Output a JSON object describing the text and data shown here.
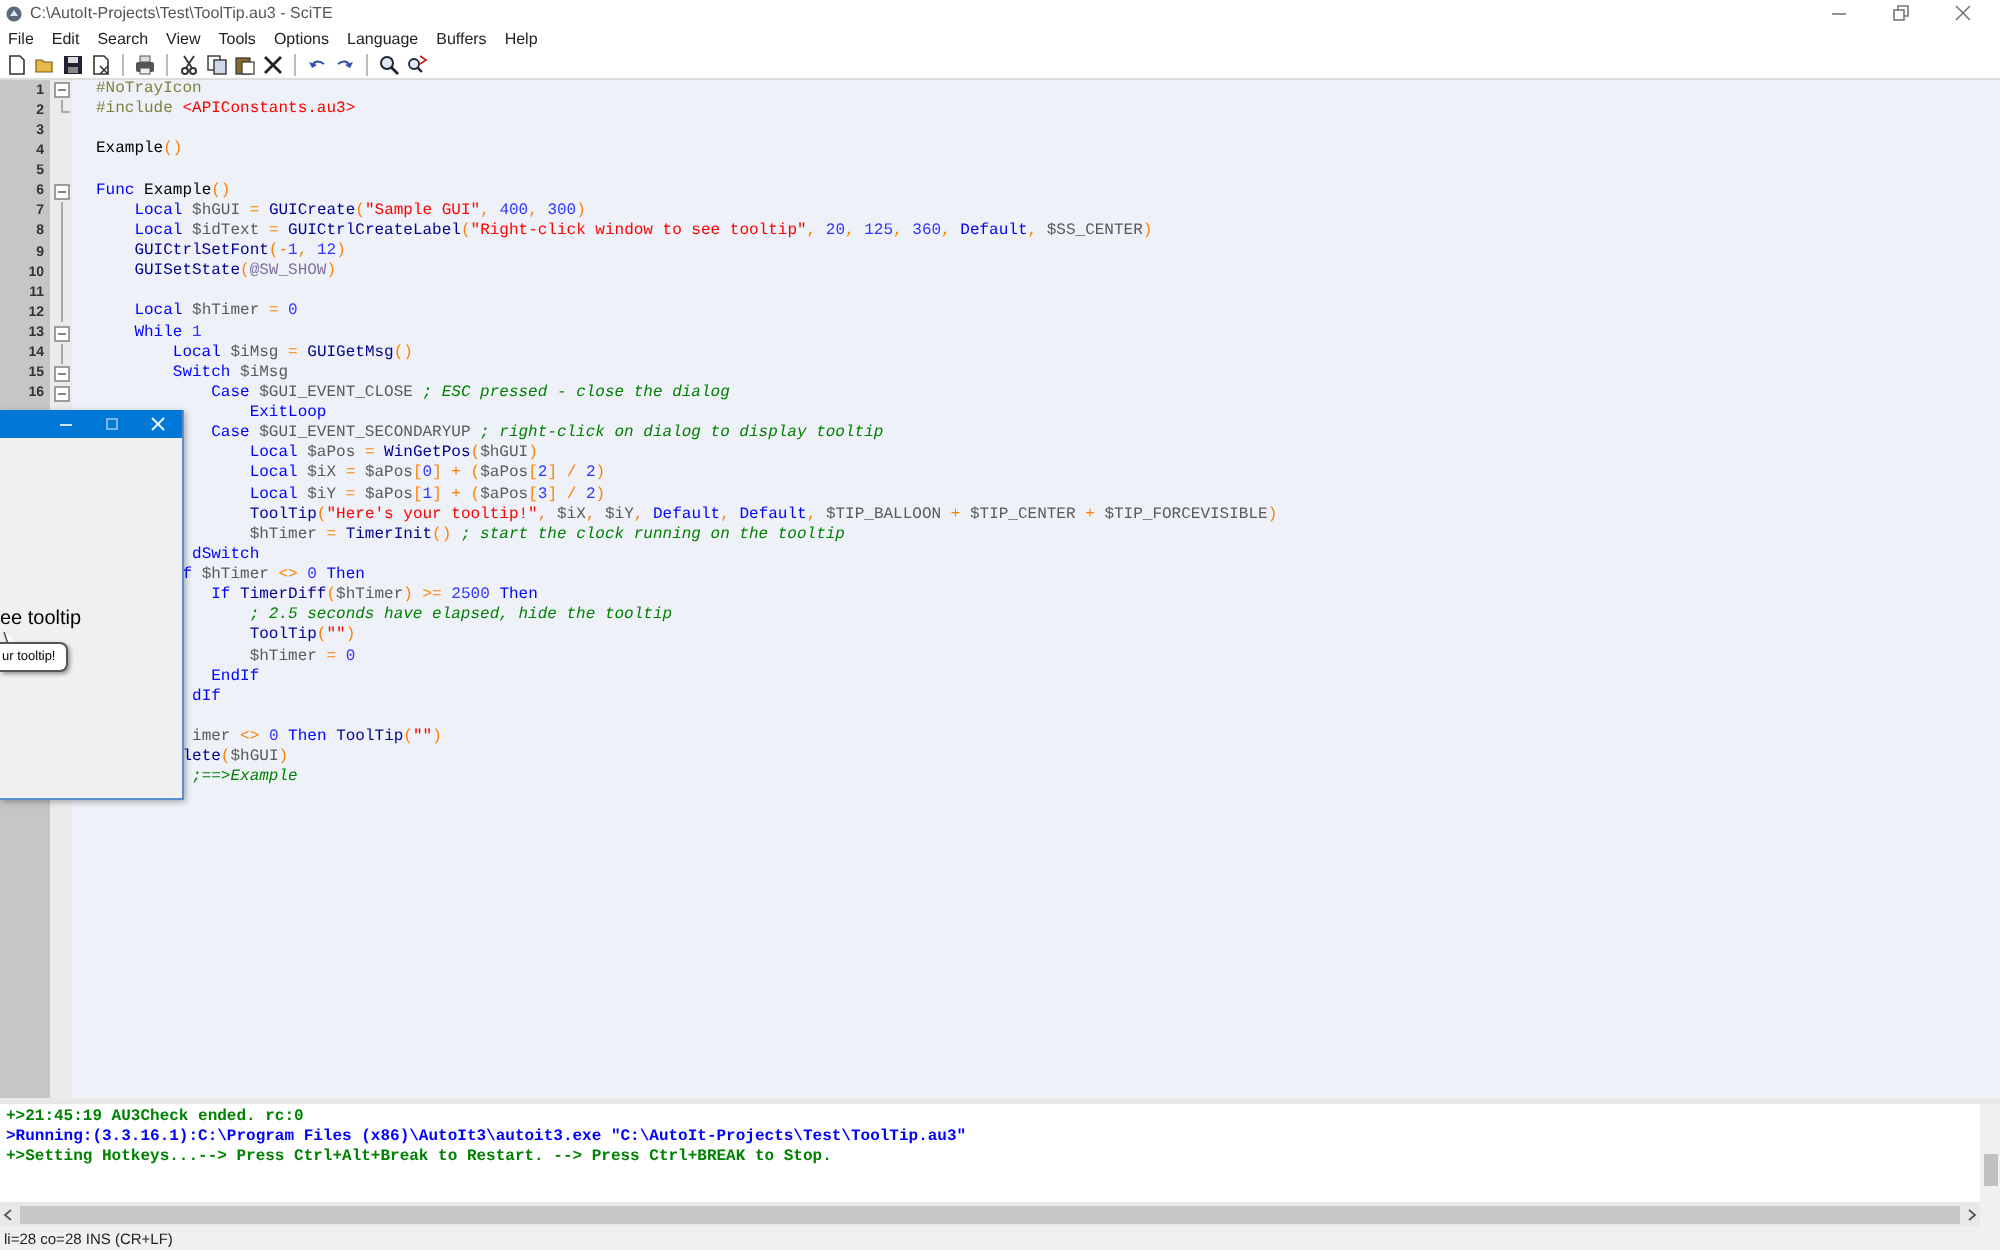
{
  "window": {
    "title": "C:\\AutoIt-Projects\\Test\\ToolTip.au3 - SciTE"
  },
  "menu": [
    "File",
    "Edit",
    "Search",
    "View",
    "Tools",
    "Options",
    "Language",
    "Buffers",
    "Help"
  ],
  "editor": {
    "lines": [
      {
        "number": "1",
        "kind": "fold",
        "expanded": true,
        "tokens": [
          {
            "kind": "dir",
            "text": "#NoTrayIcon"
          }
        ]
      },
      {
        "number": "2",
        "kind": "last",
        "tokens": [
          {
            "kind": "dir",
            "text": "#include "
          },
          {
            "kind": "str",
            "text": "<APIConstants.au3>"
          }
        ]
      },
      {
        "number": "3",
        "kind": "plain"
      },
      {
        "number": "4",
        "kind": "plain",
        "tokens": [
          {
            "kind": "pl",
            "text": "Example"
          },
          {
            "kind": "op",
            "text": "()"
          }
        ]
      },
      {
        "number": "5",
        "kind": "plain"
      },
      {
        "number": "6",
        "kind": "fold",
        "expanded": true,
        "tokens": [
          {
            "kind": "kw",
            "text": "Func "
          },
          {
            "kind": "pl",
            "text": "Example"
          },
          {
            "kind": "op",
            "text": "()"
          }
        ]
      },
      {
        "number": "7",
        "kind": "inner",
        "tokens": [
          {
            "kind": "kw",
            "text": "    Local "
          },
          {
            "kind": "var",
            "text": "$hGUI "
          },
          {
            "kind": "op",
            "text": "= "
          },
          {
            "kind": "fn",
            "text": "GUICreate"
          },
          {
            "kind": "op",
            "text": "("
          },
          {
            "kind": "str",
            "text": "\"Sample GUI\""
          },
          {
            "kind": "op",
            "text": ", "
          },
          {
            "kind": "num",
            "text": "400"
          },
          {
            "kind": "op",
            "text": ", "
          },
          {
            "kind": "num",
            "text": "300"
          },
          {
            "kind": "op",
            "text": ")"
          }
        ]
      },
      {
        "number": "8",
        "kind": "inner",
        "tokens": [
          {
            "kind": "kw",
            "text": "    Local "
          },
          {
            "kind": "var",
            "text": "$idText "
          },
          {
            "kind": "op",
            "text": "= "
          },
          {
            "kind": "fn",
            "text": "GUICtrlCreateLabel"
          },
          {
            "kind": "op",
            "text": "("
          },
          {
            "kind": "str",
            "text": "\"Right-click window to see tooltip\""
          },
          {
            "kind": "op",
            "text": ", "
          },
          {
            "kind": "num",
            "text": "20"
          },
          {
            "kind": "op",
            "text": ", "
          },
          {
            "kind": "num",
            "text": "125"
          },
          {
            "kind": "op",
            "text": ", "
          },
          {
            "kind": "num",
            "text": "360"
          },
          {
            "kind": "op",
            "text": ", "
          },
          {
            "kind": "kw",
            "text": "Default"
          },
          {
            "kind": "op",
            "text": ", "
          },
          {
            "kind": "var",
            "text": "$SS_CENTER"
          },
          {
            "kind": "op",
            "text": ")"
          }
        ]
      },
      {
        "number": "9",
        "kind": "inner",
        "tokens": [
          {
            "kind": "fn",
            "text": "    GUICtrlSetFont"
          },
          {
            "kind": "op",
            "text": "(-"
          },
          {
            "kind": "num",
            "text": "1"
          },
          {
            "kind": "op",
            "text": ", "
          },
          {
            "kind": "num",
            "text": "12"
          },
          {
            "kind": "op",
            "text": ")"
          }
        ]
      },
      {
        "number": "10",
        "kind": "inner",
        "tokens": [
          {
            "kind": "fn",
            "text": "    GUISetState"
          },
          {
            "kind": "op",
            "text": "("
          },
          {
            "kind": "mac",
            "text": "@SW_SHOW"
          },
          {
            "kind": "op",
            "text": ")"
          }
        ]
      },
      {
        "number": "11",
        "kind": "inner"
      },
      {
        "number": "12",
        "kind": "inner",
        "tokens": [
          {
            "kind": "kw",
            "text": "    Local "
          },
          {
            "kind": "var",
            "text": "$hTimer "
          },
          {
            "kind": "op",
            "text": "= "
          },
          {
            "kind": "num",
            "text": "0"
          }
        ]
      },
      {
        "number": "13",
        "kind": "fold",
        "expanded": true,
        "tokens": [
          {
            "kind": "kw",
            "text": "    While "
          },
          {
            "kind": "num",
            "text": "1"
          }
        ]
      },
      {
        "number": "14",
        "kind": "inner",
        "tokens": [
          {
            "kind": "kw",
            "text": "        Local "
          },
          {
            "kind": "var",
            "text": "$iMsg "
          },
          {
            "kind": "op",
            "text": "= "
          },
          {
            "kind": "fn",
            "text": "GUIGetMsg"
          },
          {
            "kind": "op",
            "text": "()"
          }
        ]
      },
      {
        "number": "15",
        "kind": "fold",
        "expanded": true,
        "tokens": [
          {
            "kind": "kw",
            "text": "        Switch "
          },
          {
            "kind": "var",
            "text": "$iMsg"
          }
        ]
      },
      {
        "number": "16",
        "kind": "fold",
        "expanded": true,
        "tokens": [
          {
            "kind": "kw",
            "text": "            Case "
          },
          {
            "kind": "var",
            "text": "$GUI_EVENT_CLOSE "
          },
          {
            "kind": "cm",
            "text": "; ESC pressed - close the dialog"
          }
        ]
      },
      {
        "kind": "plain",
        "tokens": [
          {
            "kind": "kw",
            "text": "                ExitLoop"
          }
        ]
      },
      {
        "kind": "plain",
        "tokens": [
          {
            "kind": "kw",
            "text": "            Case "
          },
          {
            "kind": "var",
            "text": "$GUI_EVENT_SECONDARYUP "
          },
          {
            "kind": "cm",
            "text": "; right-click on dialog to display tooltip"
          }
        ]
      },
      {
        "kind": "plain",
        "tokens": [
          {
            "kind": "kw",
            "text": "                Local "
          },
          {
            "kind": "var",
            "text": "$aPos "
          },
          {
            "kind": "op",
            "text": "= "
          },
          {
            "kind": "fn",
            "text": "WinGetPos"
          },
          {
            "kind": "op",
            "text": "("
          },
          {
            "kind": "var",
            "text": "$hGUI"
          },
          {
            "kind": "op",
            "text": ")"
          }
        ]
      },
      {
        "kind": "plain",
        "tokens": [
          {
            "kind": "kw",
            "text": "                Local "
          },
          {
            "kind": "var",
            "text": "$iX "
          },
          {
            "kind": "op",
            "text": "= "
          },
          {
            "kind": "var",
            "text": "$aPos"
          },
          {
            "kind": "op",
            "text": "["
          },
          {
            "kind": "num",
            "text": "0"
          },
          {
            "kind": "op",
            "text": "] + ("
          },
          {
            "kind": "var",
            "text": "$aPos"
          },
          {
            "kind": "op",
            "text": "["
          },
          {
            "kind": "num",
            "text": "2"
          },
          {
            "kind": "op",
            "text": "] / "
          },
          {
            "kind": "num",
            "text": "2"
          },
          {
            "kind": "op",
            "text": ")"
          }
        ]
      },
      {
        "kind": "plain",
        "tokens": [
          {
            "kind": "kw",
            "text": "                Local "
          },
          {
            "kind": "var",
            "text": "$iY "
          },
          {
            "kind": "op",
            "text": "= "
          },
          {
            "kind": "var",
            "text": "$aPos"
          },
          {
            "kind": "op",
            "text": "["
          },
          {
            "kind": "num",
            "text": "1"
          },
          {
            "kind": "op",
            "text": "] + ("
          },
          {
            "kind": "var",
            "text": "$aPos"
          },
          {
            "kind": "op",
            "text": "["
          },
          {
            "kind": "num",
            "text": "3"
          },
          {
            "kind": "op",
            "text": "] / "
          },
          {
            "kind": "num",
            "text": "2"
          },
          {
            "kind": "op",
            "text": ")"
          }
        ]
      },
      {
        "kind": "plain",
        "tokens": [
          {
            "kind": "fn",
            "text": "                ToolTip"
          },
          {
            "kind": "op",
            "text": "("
          },
          {
            "kind": "str",
            "text": "\"Here's your tooltip!\""
          },
          {
            "kind": "op",
            "text": ", "
          },
          {
            "kind": "var",
            "text": "$iX"
          },
          {
            "kind": "op",
            "text": ", "
          },
          {
            "kind": "var",
            "text": "$iY"
          },
          {
            "kind": "op",
            "text": ", "
          },
          {
            "kind": "kw",
            "text": "Default"
          },
          {
            "kind": "op",
            "text": ", "
          },
          {
            "kind": "kw",
            "text": "Default"
          },
          {
            "kind": "op",
            "text": ", "
          },
          {
            "kind": "var",
            "text": "$TIP_BALLOON "
          },
          {
            "kind": "op",
            "text": "+ "
          },
          {
            "kind": "var",
            "text": "$TIP_CENTER "
          },
          {
            "kind": "op",
            "text": "+ "
          },
          {
            "kind": "var",
            "text": "$TIP_FORCEVISIBLE"
          },
          {
            "kind": "op",
            "text": ")"
          }
        ]
      },
      {
        "kind": "plain",
        "tokens": [
          {
            "kind": "var",
            "text": "                $hTimer "
          },
          {
            "kind": "op",
            "text": "= "
          },
          {
            "kind": "fn",
            "text": "TimerInit"
          },
          {
            "kind": "op",
            "text": "() "
          },
          {
            "kind": "cm",
            "text": "; start the clock running on the tooltip"
          }
        ]
      },
      {
        "kind": "plain",
        "tokens": [
          {
            "kind": "kw",
            "text": "          dSwitch"
          }
        ]
      },
      {
        "kind": "plain",
        "tokens": [
          {
            "kind": "kw",
            "text": "         f "
          },
          {
            "kind": "var",
            "text": "$hTimer "
          },
          {
            "kind": "op",
            "text": "<> "
          },
          {
            "kind": "num",
            "text": "0 "
          },
          {
            "kind": "kw",
            "text": "Then"
          }
        ]
      },
      {
        "kind": "plain",
        "tokens": [
          {
            "kind": "kw",
            "text": "            If "
          },
          {
            "kind": "fn",
            "text": "TimerDiff"
          },
          {
            "kind": "op",
            "text": "("
          },
          {
            "kind": "var",
            "text": "$hTimer"
          },
          {
            "kind": "op",
            "text": ") >= "
          },
          {
            "kind": "num",
            "text": "2500 "
          },
          {
            "kind": "kw",
            "text": "Then"
          }
        ]
      },
      {
        "kind": "plain",
        "tokens": [
          {
            "kind": "cm",
            "text": "                ; 2.5 seconds have elapsed, hide the tooltip"
          }
        ]
      },
      {
        "kind": "plain",
        "tokens": [
          {
            "kind": "fn",
            "text": "                ToolTip"
          },
          {
            "kind": "op",
            "text": "("
          },
          {
            "kind": "str",
            "text": "\"\""
          },
          {
            "kind": "op",
            "text": ")"
          }
        ]
      },
      {
        "kind": "plain",
        "tokens": [
          {
            "kind": "var",
            "text": "                $hTimer "
          },
          {
            "kind": "op",
            "text": "= "
          },
          {
            "kind": "num",
            "text": "0"
          }
        ]
      },
      {
        "kind": "plain",
        "tokens": [
          {
            "kind": "kw",
            "text": "            EndIf"
          }
        ]
      },
      {
        "kind": "plain",
        "tokens": [
          {
            "kind": "kw",
            "text": "          dIf"
          }
        ]
      },
      {
        "kind": "plain"
      },
      {
        "kind": "plain",
        "tokens": [
          {
            "kind": "var",
            "text": "          imer "
          },
          {
            "kind": "op",
            "text": "<> "
          },
          {
            "kind": "num",
            "text": "0 "
          },
          {
            "kind": "kw",
            "text": "Then "
          },
          {
            "kind": "fn",
            "text": "ToolTip"
          },
          {
            "kind": "op",
            "text": "("
          },
          {
            "kind": "str",
            "text": "\"\""
          },
          {
            "kind": "op",
            "text": ")"
          }
        ]
      },
      {
        "kind": "plain",
        "tokens": [
          {
            "kind": "fn",
            "text": "         lete"
          },
          {
            "kind": "op",
            "text": "("
          },
          {
            "kind": "var",
            "text": "$hGUI"
          },
          {
            "kind": "op",
            "text": ")"
          }
        ]
      },
      {
        "kind": "plain",
        "tokens": [
          {
            "kind": "cm",
            "text": "          ;==>Example"
          }
        ]
      }
    ]
  },
  "output": {
    "lines": [
      {
        "kind": "ok",
        "text": "+>21:45:19 AU3Check ended. rc:0"
      },
      {
        "kind": "run",
        "text": ">Running:(3.3.16.1):C:\\Program Files (x86)\\AutoIt3\\autoit3.exe \"C:\\AutoIt-Projects\\Test\\ToolTip.au3\""
      },
      {
        "kind": "ok",
        "text": "+>Setting Hotkeys...--> Press Ctrl+Alt+Break to Restart. --> Press Ctrl+BREAK to Stop."
      }
    ]
  },
  "status_bar": "li=28 co=28 INS (CR+LF)",
  "dialog": {
    "label": "ee tooltip",
    "tooltip": "ur tooltip!"
  }
}
